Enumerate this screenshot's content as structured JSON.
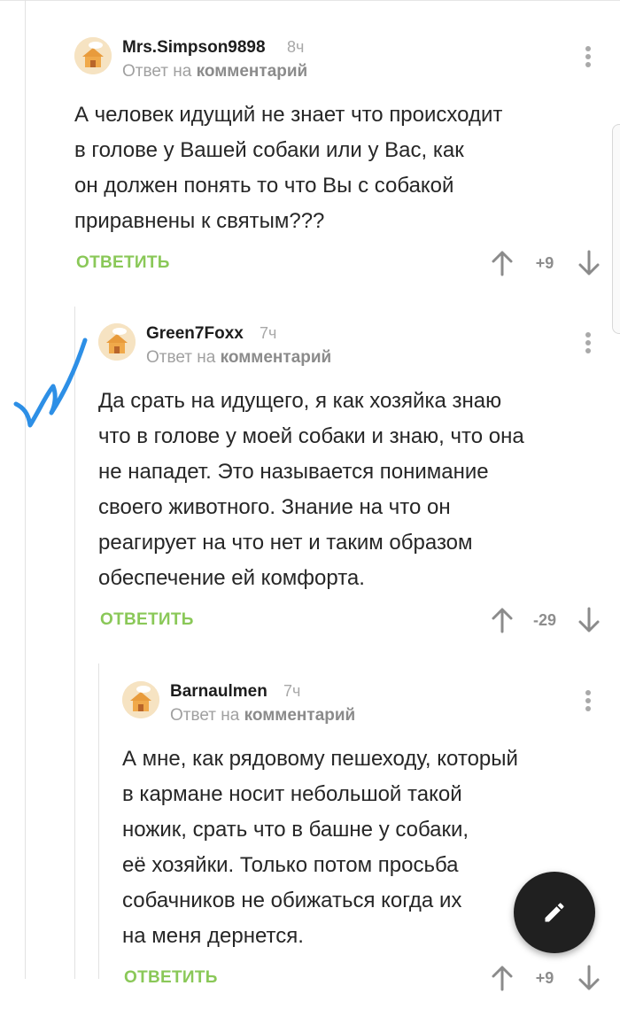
{
  "comments": [
    {
      "author": "Mrs.Simpson9898",
      "time": "8ч",
      "reply_prefix": "Ответ на",
      "reply_link": "комментарий",
      "lines": [
        "А человек идущий не знает что происходит",
        "в голове у Вашей собаки или у Вас, как",
        "он должен понять то что Вы с собакой",
        "приравнены к святым???"
      ],
      "reply_label": "ОТВЕТИТЬ",
      "score": "+9"
    },
    {
      "author": "Green7Foxx",
      "time": "7ч",
      "reply_prefix": "Ответ на",
      "reply_link": "комментарий",
      "lines": [
        "Да срать на идущего, я как хозяйка знаю",
        "что в голове у моей собаки и знаю, что она",
        "не нападет. Это называется понимание",
        "своего животного. Знание на что он",
        "реагирует на что нет и таким образом",
        "обеспечение ей комфорта."
      ],
      "reply_label": "ОТВЕТИТЬ",
      "score": "-29"
    },
    {
      "author": "Barnaulmen",
      "time": "7ч",
      "reply_prefix": "Ответ на",
      "reply_link": "комментарий",
      "lines": [
        "А мне, как рядовому пешеходу, который",
        "в кармане носит небольшой такой",
        "ножик, срать что в башне у собаки,",
        "её хозяйки. Только потом просьба",
        "собачников не обижаться когда их",
        "на меня дернется."
      ],
      "reply_label": "ОТВЕТИТЬ",
      "score": "+9"
    }
  ],
  "icons": {
    "avatar": "default-avatar-house-icon",
    "menu": "more-vertical-icon",
    "upvote": "arrow-up-icon",
    "downvote": "arrow-down-icon",
    "fab": "pencil-icon",
    "overlay": "checkmark-doodle-icon"
  },
  "colors": {
    "accent_green": "#8ac858",
    "author": "#1d1d1d",
    "meta_gray": "#a0a0a0",
    "fab_bg": "#202020",
    "doodle_blue": "#2d8fe6"
  }
}
